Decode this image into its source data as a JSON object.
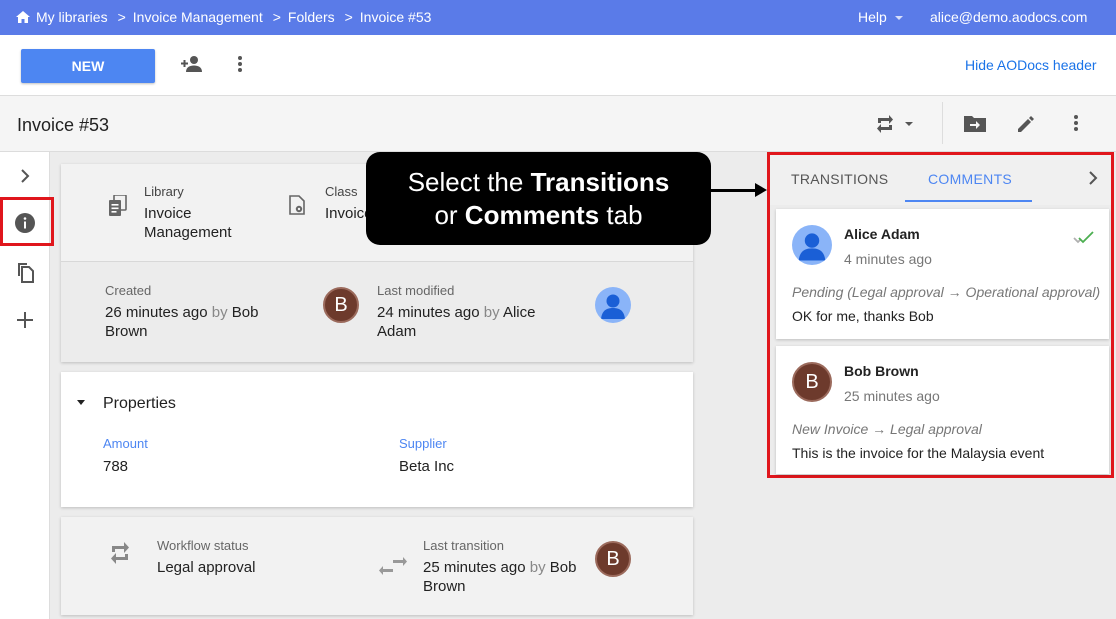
{
  "breadcrumb": [
    "My libraries",
    "Invoice Management",
    "Folders",
    "Invoice #53"
  ],
  "topbar": {
    "help": "Help",
    "user": "alice@demo.aodocs.com"
  },
  "actionbar": {
    "new_label": "NEW",
    "hide_header": "Hide AODocs header"
  },
  "document": {
    "title": "Invoice #53"
  },
  "info": {
    "library_label": "Library",
    "library_value": "Invoice Management",
    "class_label": "Class",
    "class_value": "Invoice",
    "created_label": "Created",
    "created_time": "26 minutes ago",
    "created_by_word": "by",
    "created_by": "Bob Brown",
    "modified_label": "Last modified",
    "modified_time": "24 minutes ago",
    "modified_by_word": "by",
    "modified_by": "Alice Adam",
    "avatar_b": "B"
  },
  "properties": {
    "title": "Properties",
    "amount_label": "Amount",
    "amount_value": "788",
    "supplier_label": "Supplier",
    "supplier_value": "Beta Inc"
  },
  "workflow": {
    "status_label": "Workflow status",
    "status_value": "Legal approval",
    "last_label": "Last transition",
    "last_time": "25 minutes ago",
    "last_by_word": "by",
    "last_by": "Bob Brown",
    "avatar_b": "B"
  },
  "callout": {
    "line1_a": "Select the ",
    "line1_b": "Transitions",
    "line2_a": "or ",
    "line2_b": "Comments",
    "line2_c": " tab"
  },
  "panel": {
    "tab1": "TRANSITIONS",
    "tab2": "COMMENTS",
    "comments": [
      {
        "name": "Alice Adam",
        "time": "4 minutes ago",
        "transition": "Pending (Legal approval → Operational approval)",
        "text": "OK for me, thanks Bob"
      },
      {
        "name": "Bob Brown",
        "time": "25 minutes ago",
        "transition": "New Invoice → Legal approval",
        "text": "This is the invoice for the Malaysia event",
        "avatar": "B"
      }
    ]
  },
  "colors": {
    "topbar": "#5a7be8",
    "primary": "#4d86f2",
    "highlight": "#e0161c"
  }
}
